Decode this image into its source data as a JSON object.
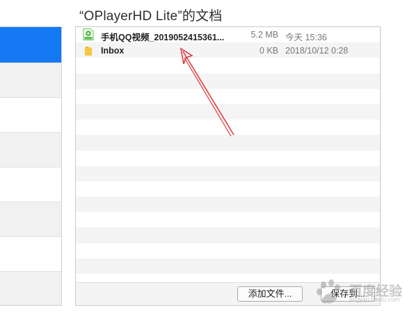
{
  "window": {
    "title": "“OPlayerHD Lite”的文档"
  },
  "files": [
    {
      "name": "手机QQ视频_2019052415361...",
      "size": "5.2 MB",
      "date": "今天 15:36",
      "icon": "mp4-file-icon"
    },
    {
      "name": "Inbox",
      "size": "0 KB",
      "date": "2018/10/12 0:28",
      "icon": "folder-icon"
    }
  ],
  "buttons": {
    "add_file": "添加文件...",
    "save_to": "保存到..."
  },
  "watermark": {
    "text": "百度经验",
    "url": "jingyan.baidu.com"
  },
  "colors": {
    "selection": "#1479f2",
    "arrow": "#e0393c"
  }
}
